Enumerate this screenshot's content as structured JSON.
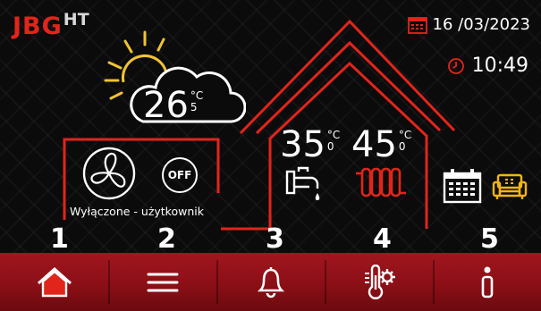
{
  "brand": {
    "name": "JBG",
    "sup": "HT"
  },
  "header": {
    "date": "16 /03/2023",
    "time": "10:49"
  },
  "weather": {
    "temp_main": "26",
    "unit": "°C",
    "temp_decimal": "5"
  },
  "status": {
    "label": "Wyłączone - użytkownik",
    "off_label": "OFF"
  },
  "water": {
    "temp_main": "35",
    "unit": "°C",
    "temp_decimal": "0"
  },
  "heating": {
    "temp_main": "45",
    "unit": "°C",
    "temp_decimal": "0"
  },
  "nav": {
    "items": [
      {
        "number": "1",
        "icon": "home-icon"
      },
      {
        "number": "2",
        "icon": "menu-icon"
      },
      {
        "number": "3",
        "icon": "bell-icon"
      },
      {
        "number": "4",
        "icon": "thermometer-gear-icon"
      },
      {
        "number": "5",
        "icon": "info-icon"
      }
    ]
  },
  "colors": {
    "accent": "#e1251b",
    "nav_bg": "#8b0f16",
    "schedule_yellow": "#f5b414"
  }
}
